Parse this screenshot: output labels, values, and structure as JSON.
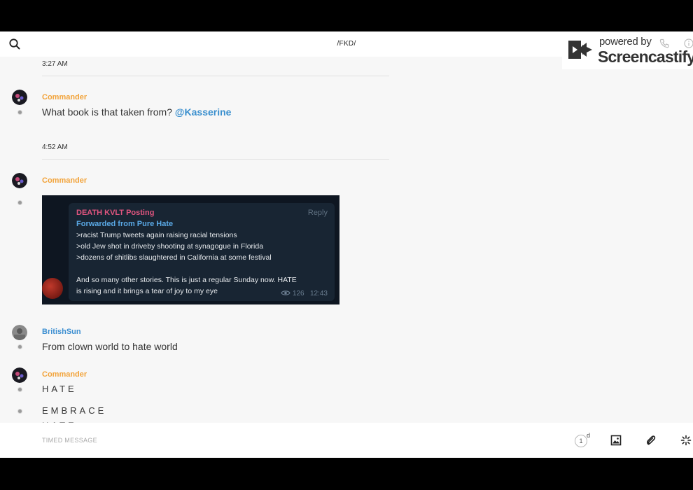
{
  "header": {
    "title": "/FKD/"
  },
  "watermark": {
    "line1": "powered by",
    "line2": "Screencastify"
  },
  "messages": [
    {
      "time": "3:27 AM"
    },
    {
      "user": "Commander",
      "text": "What book is that taken from?",
      "mention": "@Kasserine"
    },
    {
      "time": "4:52 AM"
    },
    {
      "user": "Commander"
    },
    {
      "user": "BritishSun",
      "text": "From clown world to hate world"
    },
    {
      "user": "Commander",
      "lines": [
        "HATE",
        "EMBRACE",
        "HATE"
      ]
    }
  ],
  "attachment": {
    "channel": "DEATH KVLT Posting",
    "reply": "Reply",
    "forwarded": "Forwarded from Pure Hate",
    "lines": [
      ">racist Trump tweets again raising racial tensions",
      ">old Jew shot in driveby shooting at synagogue in Florida",
      ">dozens of shitlibs slaughtered in California at some festival",
      "",
      "And so many other stories. This is just a regular Sunday now. HATE",
      "is rising and it brings a tear of joy to my eye"
    ],
    "views": "126",
    "time": "12:43"
  },
  "composer": {
    "placeholder": "TIMED MESSAGE",
    "timer_value": "1",
    "timer_unit": "d"
  },
  "colors": {
    "username_orange": "#f2a33a",
    "username_blue": "#3d8fd1",
    "mention": "#3a8fce"
  },
  "icons": [
    "search-icon",
    "phone-icon",
    "info-icon",
    "timer-icon",
    "image-icon",
    "paperclip-icon",
    "sparkle-icon"
  ]
}
